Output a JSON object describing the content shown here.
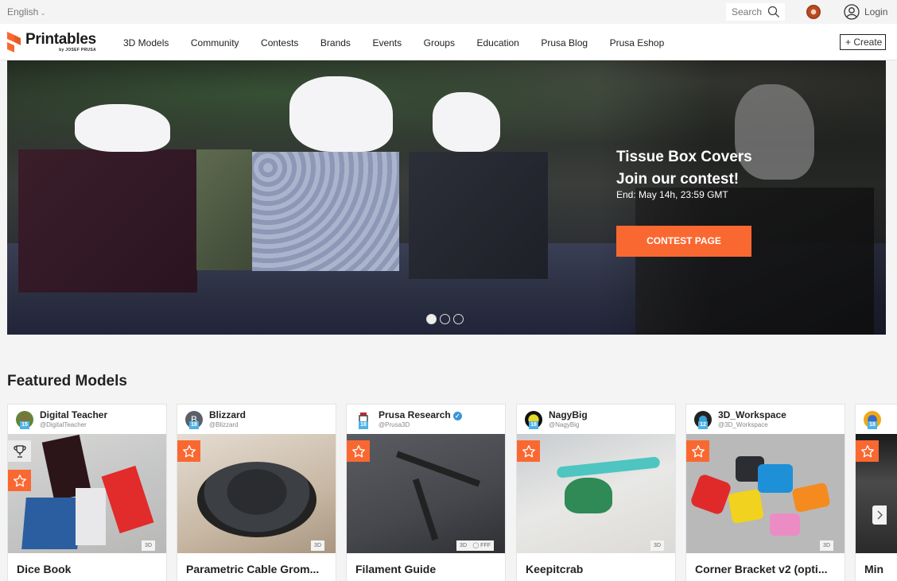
{
  "topbar": {
    "language": "English",
    "search_placeholder": "Search",
    "login_label": "Login"
  },
  "brand": {
    "name": "Printables",
    "sub": "by JOSEF PRUSA",
    "accent": "#fa6831"
  },
  "nav": {
    "items": [
      "3D Models",
      "Community",
      "Contests",
      "Brands",
      "Events",
      "Groups",
      "Education",
      "Prusa Blog",
      "Prusa Eshop"
    ],
    "create_label": "+ Create"
  },
  "hero": {
    "title_line1": "Tissue Box Covers",
    "title_line2": "Join our contest!",
    "end_text": "End: May 14h, 23:59 GMT",
    "cta_label": "CONTEST PAGE",
    "slides_total": 3,
    "active_slide": 1
  },
  "featured": {
    "title": "Featured Models",
    "cards": [
      {
        "author": "Digital Teacher",
        "handle": "@DigitalTeacher",
        "level": "15",
        "title": "Dice Book",
        "tags": [
          "3D"
        ],
        "trophy": true,
        "verified": false
      },
      {
        "author": "Blizzard",
        "handle": "@Blizzard",
        "level": "18",
        "title": "Parametric Cable Grom...",
        "tags": [
          "3D"
        ],
        "trophy": false,
        "verified": false,
        "avatar_letter": "B"
      },
      {
        "author": "Prusa Research",
        "handle": "@Prusa3D",
        "level": "18",
        "title": "Filament Guide",
        "tags": [
          "3D",
          "FFF"
        ],
        "trophy": false,
        "verified": true
      },
      {
        "author": "NagyBig",
        "handle": "@NagyBig",
        "level": "18",
        "title": "Keepitcrab",
        "tags": [
          "3D"
        ],
        "trophy": false,
        "verified": false
      },
      {
        "author": "3D_Workspace",
        "handle": "@3D_Workspace",
        "level": "12",
        "title": "Corner Bracket v2 (opti...",
        "tags": [
          "3D"
        ],
        "trophy": false,
        "verified": false
      },
      {
        "author": "",
        "handle": "",
        "level": "18",
        "title": "Min",
        "tags": [],
        "trophy": false,
        "verified": false
      }
    ]
  }
}
